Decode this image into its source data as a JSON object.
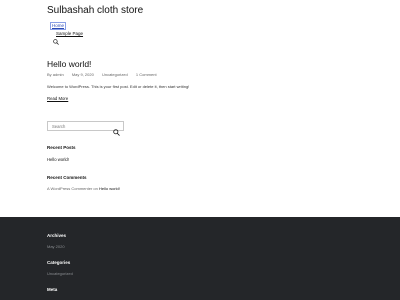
{
  "header": {
    "site_title": "Sulbashah cloth store",
    "menu": [
      {
        "label": "Home"
      },
      {
        "label": "Sample Page"
      }
    ],
    "search_icon": "search-icon"
  },
  "post": {
    "title": "Hello world!",
    "meta": {
      "author": "By admin",
      "date": "May 9, 2020",
      "category": "Uncategorized",
      "comments": "1 Comment"
    },
    "excerpt": "Welcome to WordPress. This is your first post. Edit or delete it, then start writing!",
    "read_more": "Read More"
  },
  "sidebar": {
    "search_placeholder": "Search",
    "recent_posts_heading": "Recent Posts",
    "recent_posts": [
      "Hello world!"
    ],
    "recent_comments_heading": "Recent Comments",
    "recent_comment": {
      "author": "A WordPress Commenter",
      "connector": "on",
      "post": "Hello world!"
    }
  },
  "footer": {
    "archives_heading": "Archives",
    "archives": [
      "May 2020"
    ],
    "categories_heading": "Categories",
    "categories": [
      "Uncategorized"
    ],
    "meta_heading": "Meta"
  },
  "colors": {
    "footer_bg": "#242629",
    "link_accent": "#2a49b5"
  }
}
